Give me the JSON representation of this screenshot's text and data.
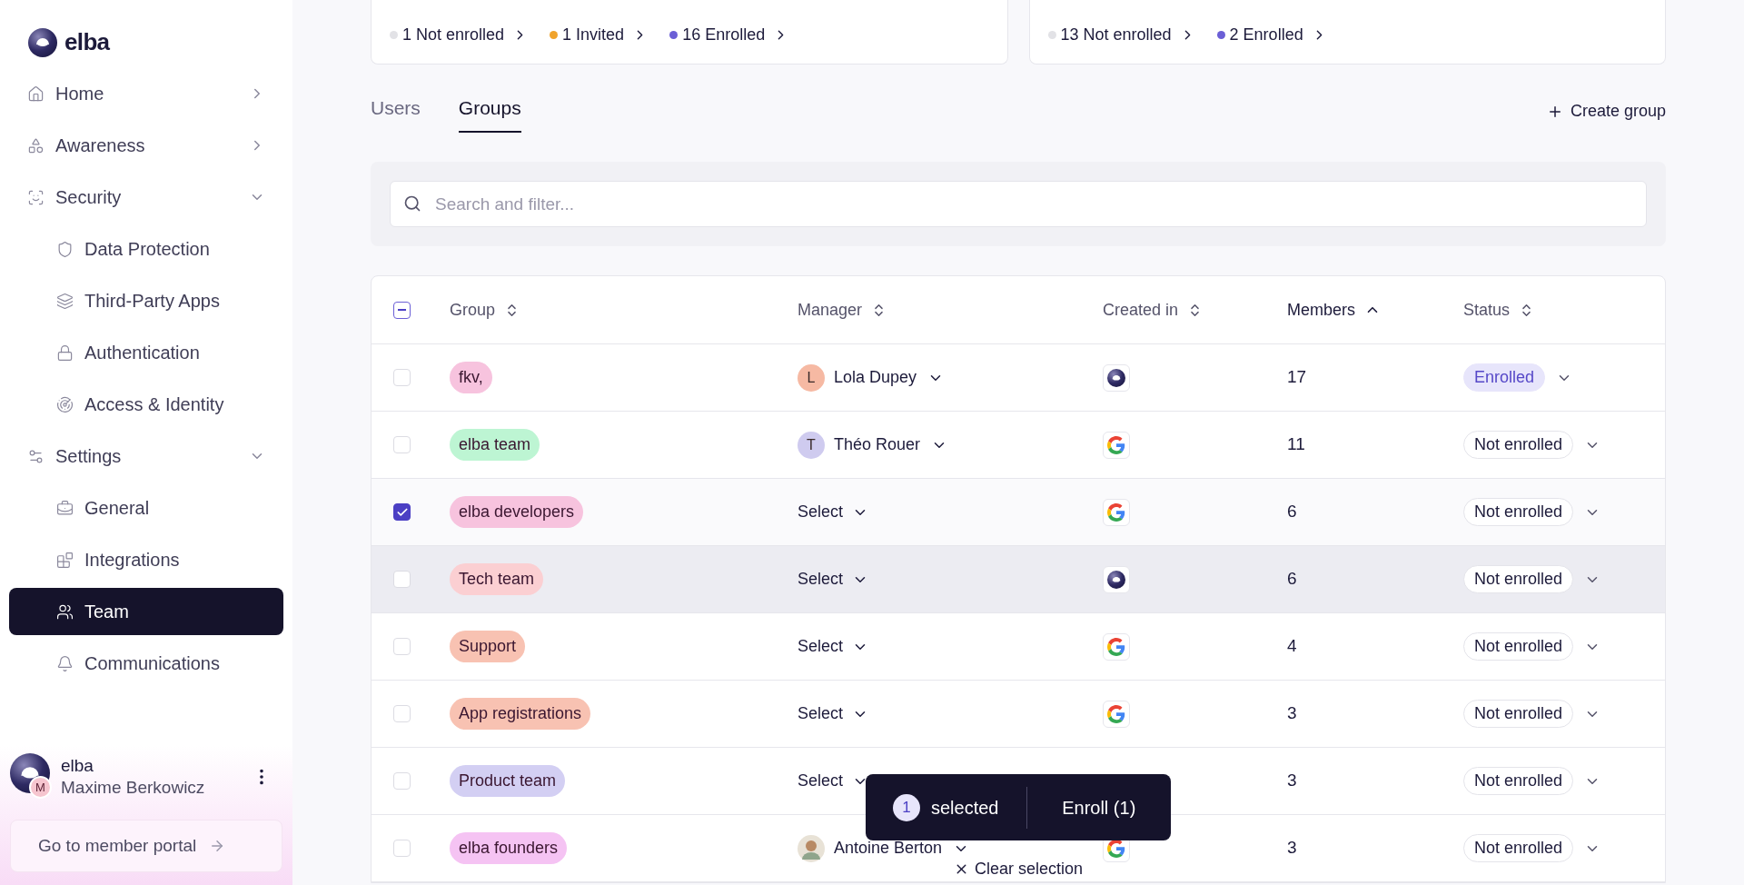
{
  "brand": {
    "name": "elba"
  },
  "sidebar": {
    "items": [
      {
        "label": "Home",
        "selected": false,
        "expanded": false
      },
      {
        "label": "Awareness",
        "selected": false,
        "expanded": false
      },
      {
        "label": "Security",
        "selected": false,
        "expanded": true,
        "children": [
          {
            "label": "Data Protection",
            "selected": false
          },
          {
            "label": "Third-Party Apps",
            "selected": false
          },
          {
            "label": "Authentication",
            "selected": false
          },
          {
            "label": "Access & Identity",
            "selected": false
          }
        ]
      },
      {
        "label": "Settings",
        "selected": false,
        "expanded": true,
        "children": [
          {
            "label": "General",
            "selected": false
          },
          {
            "label": "Integrations",
            "selected": false
          },
          {
            "label": "Team",
            "selected": true
          },
          {
            "label": "Communications",
            "selected": false
          }
        ]
      }
    ],
    "account": {
      "org": "elba",
      "user": "Maxime Berkowicz",
      "initial": "M"
    },
    "portal_button": "Go to member portal"
  },
  "cards": [
    {
      "stats": [
        {
          "label": "1 Not enrolled",
          "color": "#e2e2e6"
        },
        {
          "label": "1 Invited",
          "color": "#f0a32c"
        },
        {
          "label": "16 Enrolled",
          "color": "#6b5fd6"
        }
      ]
    },
    {
      "stats": [
        {
          "label": "13 Not enrolled",
          "color": "#e2e2e6"
        },
        {
          "label": "2 Enrolled",
          "color": "#6b5fd6"
        }
      ]
    }
  ],
  "tabs": [
    {
      "label": "Users",
      "selected": false
    },
    {
      "label": "Groups",
      "selected": true
    }
  ],
  "create_button": "Create group",
  "search": {
    "placeholder": "Search and filter..."
  },
  "table": {
    "header_checkbox": {
      "indeterminate": true
    },
    "columns": [
      {
        "label": "Group",
        "sorted": false
      },
      {
        "label": "Manager",
        "sorted": false
      },
      {
        "label": "Created in",
        "sorted": false
      },
      {
        "label": "Members",
        "sorted": true
      },
      {
        "label": "Status",
        "sorted": false
      }
    ],
    "rows": [
      {
        "checked": false,
        "hovered": false,
        "group": "fkv,",
        "color": "#f7c3de",
        "manager": {
          "kind": "person",
          "name": "Lola Dupey",
          "initial": "L",
          "color": "#f6b9a3"
        },
        "created_in": {
          "kind": "elba"
        },
        "members": "17",
        "status": {
          "kind": "enrolled",
          "label": "Enrolled"
        }
      },
      {
        "checked": false,
        "hovered": false,
        "group": "elba team",
        "color": "#bdf5d3",
        "manager": {
          "kind": "person",
          "name": "Théo Rouer",
          "initial": "T",
          "color": "#cfcbef"
        },
        "created_in": {
          "kind": "google"
        },
        "members": "11",
        "status": {
          "kind": "not_enrolled",
          "label": "Not enrolled"
        }
      },
      {
        "checked": true,
        "hovered": false,
        "group": "elba developers",
        "color": "#f7c3de",
        "manager": {
          "kind": "select",
          "name": "Select"
        },
        "created_in": {
          "kind": "google"
        },
        "members": "6",
        "status": {
          "kind": "not_enrolled",
          "label": "Not enrolled"
        }
      },
      {
        "checked": false,
        "hovered": true,
        "group": "Tech team",
        "color": "#fbcfd2",
        "manager": {
          "kind": "select",
          "name": "Select"
        },
        "created_in": {
          "kind": "elba"
        },
        "members": "6",
        "status": {
          "kind": "not_enrolled",
          "label": "Not enrolled"
        }
      },
      {
        "checked": false,
        "hovered": false,
        "group": "Support",
        "color": "#f8c2b2",
        "manager": {
          "kind": "select",
          "name": "Select"
        },
        "created_in": {
          "kind": "google"
        },
        "members": "4",
        "status": {
          "kind": "not_enrolled",
          "label": "Not enrolled"
        }
      },
      {
        "checked": false,
        "hovered": false,
        "group": "App registrations",
        "color": "#f8c2b2",
        "manager": {
          "kind": "select",
          "name": "Select"
        },
        "created_in": {
          "kind": "google"
        },
        "members": "3",
        "status": {
          "kind": "not_enrolled",
          "label": "Not enrolled"
        }
      },
      {
        "checked": false,
        "hovered": false,
        "group": "Product team",
        "color": "#d3cff3",
        "manager": {
          "kind": "select",
          "name": "Select"
        },
        "members": "3",
        "status": {
          "kind": "not_enrolled",
          "label": "Not enrolled"
        }
      },
      {
        "checked": false,
        "hovered": false,
        "group": "elba founders",
        "color": "#f5c3f3",
        "manager": {
          "kind": "photo",
          "name": "Antoine Berton"
        },
        "created_in": {
          "kind": "google"
        },
        "members": "3",
        "status": {
          "kind": "not_enrolled",
          "label": "Not enrolled"
        }
      }
    ]
  },
  "selection_bar": {
    "count": "1",
    "label": "selected",
    "action": "Enroll (1)",
    "clear": "Clear selection"
  }
}
